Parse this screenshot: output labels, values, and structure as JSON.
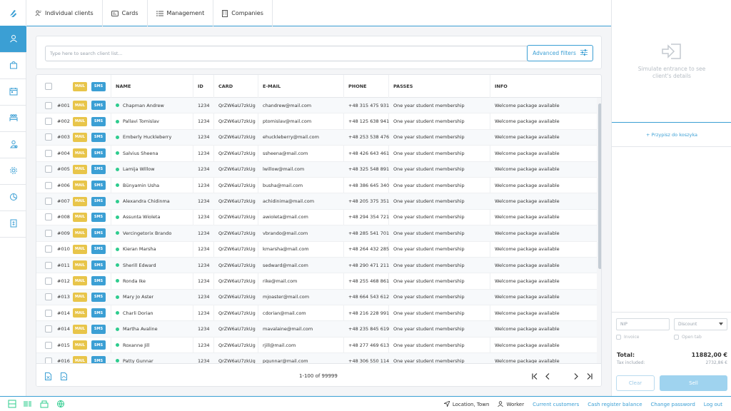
{
  "nav": {
    "tabs": [
      {
        "label": "Individual clients",
        "icon": "user-icon"
      },
      {
        "label": "Cards",
        "icon": "card-icon"
      },
      {
        "label": "Management",
        "icon": "list-icon"
      },
      {
        "label": "Companies",
        "icon": "building-icon"
      }
    ]
  },
  "sidebar": {
    "items": [
      "user-icon",
      "bag-icon",
      "calendar-icon",
      "classes-icon",
      "staff-icon",
      "settings-icon",
      "chart-icon",
      "invoice-icon"
    ],
    "active": 0
  },
  "search": {
    "placeholder": "Type here to search client list...",
    "advanced_label": "Advanced filters"
  },
  "table": {
    "mail_label": "MAIL",
    "sms_label": "SMS",
    "columns": {
      "name": "NAME",
      "id": "ID",
      "card": "CARD",
      "email": "E-MAIL",
      "phone": "PHONE",
      "passes": "PASSES",
      "info": "INFO"
    },
    "rows": [
      {
        "no": "#001",
        "name": "Chapman Andrew",
        "id": "1234",
        "card": "QrZW6aU7zkUg",
        "email": "chandrew@mail.com",
        "phone": "+48 315 475 931",
        "passes": "One year student membership",
        "info": "Welcome package available"
      },
      {
        "no": "#002",
        "name": "Pallavi Tomislav",
        "id": "1234",
        "card": "QrZW6aU7zkUg",
        "email": "ptomislav@mail.com",
        "phone": "+48 125 638 941",
        "passes": "One year student membership",
        "info": "Welcome package available"
      },
      {
        "no": "#003",
        "name": "Emberly Huckleberry",
        "id": "1234",
        "card": "QrZW6aU7zkUg",
        "email": "ehuckleberry@mail.com",
        "phone": "+48 253 538 476",
        "passes": "One year student membership",
        "info": "Welcome package available"
      },
      {
        "no": "#004",
        "name": "Salvius Sheena",
        "id": "1234",
        "card": "QrZW6aU7zkUg",
        "email": "ssheena@mail.com",
        "phone": "+48 426 643 461",
        "passes": "One year student membership",
        "info": "Welcome package available"
      },
      {
        "no": "#005",
        "name": "Lamija Willow",
        "id": "1234",
        "card": "QrZW6aU7zkUg",
        "email": "lwillow@mail.com",
        "phone": "+48 325 548 891",
        "passes": "One year student membership",
        "info": "Welcome package available"
      },
      {
        "no": "#006",
        "name": "Bünyamin Usha",
        "id": "1234",
        "card": "QrZW6aU7zkUg",
        "email": "busha@mail.com",
        "phone": "+48 386 645 340",
        "passes": "One year student membership",
        "info": "Welcome package available"
      },
      {
        "no": "#007",
        "name": "Alexandra Chidinma",
        "id": "1234",
        "card": "QrZW6aU7zkUg",
        "email": "achidinima@mail.com",
        "phone": "+48 205 375 351",
        "passes": "One year student membership",
        "info": "Welcome package available"
      },
      {
        "no": "#008",
        "name": "Assunta Wioleta",
        "id": "1234",
        "card": "QrZW6aU7zkUg",
        "email": "awioleta@mail.com",
        "phone": "+48 294 354 721",
        "passes": "One year student membership",
        "info": "Welcome package available"
      },
      {
        "no": "#009",
        "name": "Vercingetorix Brando",
        "id": "1234",
        "card": "QrZW6aU7zkUg",
        "email": "vbrando@mail.com",
        "phone": "+48 285 541 701",
        "passes": "One year student membership",
        "info": "Welcome package available"
      },
      {
        "no": "#010",
        "name": "Kieran Marsha",
        "id": "1234",
        "card": "QrZW6aU7zkUg",
        "email": "kmarsha@mail.com",
        "phone": "+48 264 432 285",
        "passes": "One year student membership",
        "info": "Welcome package available"
      },
      {
        "no": "#011",
        "name": "Sherill Edward",
        "id": "1234",
        "card": "QrZW6aU7zkUg",
        "email": "sedward@mail.com",
        "phone": "+48 290 471 211",
        "passes": "One year student membership",
        "info": "Welcome package available"
      },
      {
        "no": "#012",
        "name": "Ronda Ike",
        "id": "1234",
        "card": "QrZW6aU7zkUg",
        "email": "rike@mail.com",
        "phone": "+48 255 468 861",
        "passes": "One year student membership",
        "info": "Welcome package available"
      },
      {
        "no": "#013",
        "name": "Mary Jo Aster",
        "id": "1234",
        "card": "QrZW6aU7zkUg",
        "email": "mjoaster@mail.com",
        "phone": "+48 664 543 612",
        "passes": "One year student membership",
        "info": "Welcome package available"
      },
      {
        "no": "#014",
        "name": "Charli Dorian",
        "id": "1234",
        "card": "QrZW6aU7zkUg",
        "email": "cdorian@mail.com",
        "phone": "+48 216 228 991",
        "passes": "One year student membership",
        "info": "Welcome package available"
      },
      {
        "no": "#014",
        "name": "Martha Avaline",
        "id": "1234",
        "card": "QrZW6aU7zkUg",
        "email": "mavalaine@mail.com",
        "phone": "+48 235 845 619",
        "passes": "One year student membership",
        "info": "Welcome package available"
      },
      {
        "no": "#015",
        "name": "Roxanne Jill",
        "id": "1234",
        "card": "QrZW6aU7zkUg",
        "email": "rjill@mail.com",
        "phone": "+48 277 469 613",
        "passes": "One year student membership",
        "info": "Welcome package available"
      },
      {
        "no": "#016",
        "name": "Patty Gunnar",
        "id": "1234",
        "card": "QrZW6aU7zkUg",
        "email": "pgunnar@mail.com",
        "phone": "+48 306 550 114",
        "passes": "One year student membership",
        "info": "Welcome package available"
      }
    ],
    "pagination": "1-100 of 99999",
    "export_icons": [
      "excel-export-icon",
      "pdf-export-icon"
    ]
  },
  "right_panel": {
    "simulate_text": "Simulate entrance to see client's details",
    "assign_label": "+ Przypisz do koszyka",
    "nip_placeholder": "NIP",
    "discount_label": "Discount",
    "invoice_label": "Invoice",
    "open_tab_label": "Open tab",
    "total_label": "Total:",
    "total_value": "11882,00 €",
    "tax_label": "Tax included:",
    "tax_value": "2732,86 €",
    "clear_label": "Clear",
    "sell_label": "Sell"
  },
  "footer": {
    "location": "Location, Town",
    "worker": "Worker",
    "links": [
      "Current customers",
      "Cash register balance",
      "Change password",
      "Log out"
    ]
  },
  "colors": {
    "accent": "#3b9fd4",
    "mail": "#e8c54a",
    "sms": "#3b9fd4",
    "status_dot": "#2ecc8e"
  }
}
